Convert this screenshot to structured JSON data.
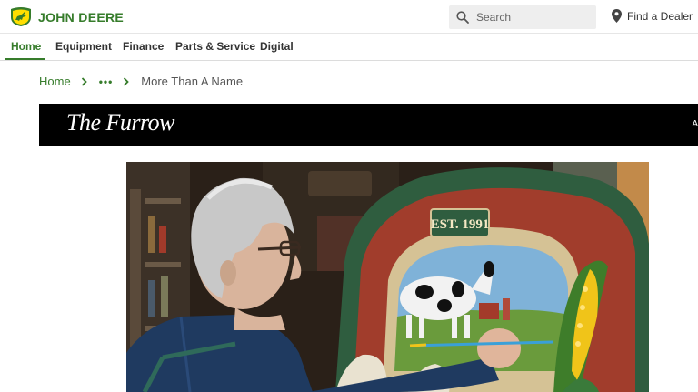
{
  "header": {
    "brand_name": "JOHN DEERE",
    "search_placeholder": "Search",
    "find_dealer_label": "Find a Dealer"
  },
  "nav": {
    "items": [
      {
        "label": "Home",
        "active": true
      },
      {
        "label": "Equipment",
        "active": false
      },
      {
        "label": "Finance",
        "active": false
      },
      {
        "label": "Parts & Service",
        "active": false
      },
      {
        "label": "Digital",
        "active": false
      }
    ]
  },
  "breadcrumb": {
    "home": "Home",
    "ellipsis": "•••",
    "current": "More Than A Name"
  },
  "banner": {
    "logo_text": "The Furrow",
    "tail_text": "A"
  },
  "hero": {
    "sign_est": "EST. 1991"
  },
  "colors": {
    "brand_green": "#367c2b",
    "brand_yellow": "#ffde00",
    "banner_bg": "#000000"
  },
  "icons": {
    "logo": "deer-logo-icon",
    "search": "search-icon",
    "dealer": "map-pin-icon",
    "chevron": "chevron-right-icon"
  }
}
